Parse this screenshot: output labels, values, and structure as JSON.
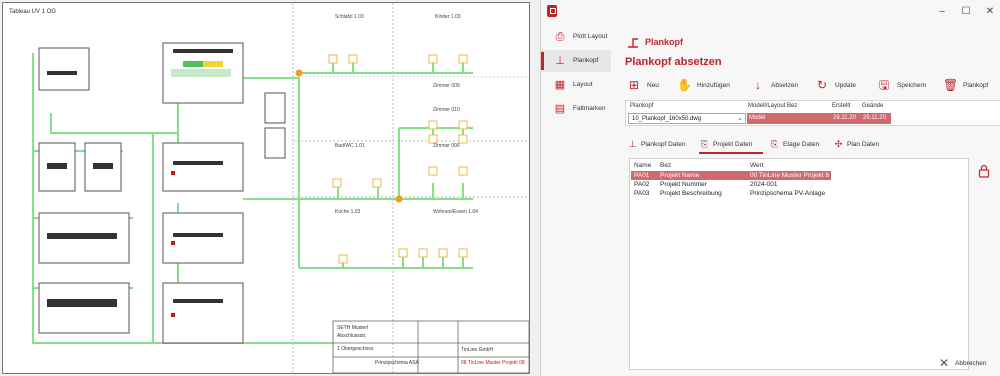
{
  "drawing": {
    "title": "Tableau UV 1 OG",
    "rooms": [
      "Schlafzi 1.03",
      "Kinder 1.03",
      "Zimmer 009",
      "Zimmer 010",
      "Bad/WC 1.01",
      "Zimmer 006",
      "Küche 1.03",
      "Wohnen/Essen 1.04"
    ],
    "titleblock": {
      "r1": "SETH Musterl",
      "r2": "Abschlussstr.",
      "r3": "1 Obergeschoss",
      "r4": "Prinzipschema ASA",
      "r5": "TinLine GmbH",
      "r6": "08 TinLine Muster Projekt 08"
    }
  },
  "window": {
    "minimize": "–",
    "maximize": "☐",
    "close": "✕"
  },
  "sidebar": {
    "items": [
      {
        "label": "Plott Layout",
        "icon": "plotter-icon"
      },
      {
        "label": "Plankopf",
        "icon": "plankopf-icon"
      },
      {
        "label": "Layout",
        "icon": "layout-icon"
      },
      {
        "label": "Faltmarken",
        "icon": "fold-marks-icon"
      }
    ]
  },
  "header": {
    "section": "Plankopf",
    "title": "Plankopf absetzen"
  },
  "toolbar": {
    "neu": "Neu",
    "hinzufuegen": "Hinzufügen",
    "absetzen": "Absetzen",
    "update": "Update",
    "speichern": "Speichern",
    "plankopf": "Plankopf"
  },
  "grid": {
    "headers": {
      "plankopf": "Plankopf",
      "modell": "Modell/Layout Bez",
      "erstellt": "Erstellt",
      "geaendert": "Geände"
    },
    "row": {
      "plankopf": "10_Plankopf_160x50.dwg",
      "modell": "Model",
      "erstellt": "29.11.20",
      "geaendert": "29.11.20"
    }
  },
  "subtabs": {
    "plankopf_daten": "Plankopf Daten",
    "projekt_daten": "Projekt Daten",
    "etage_daten": "Etage Daten",
    "plan_daten": "Plan Daten"
  },
  "list": {
    "headers": {
      "name": "Name",
      "bez": "Bez",
      "wert": "Wert"
    },
    "rows": [
      {
        "name": "PA01",
        "bez": "Projekt Name",
        "wert": "00 TinLine Muster Projekt 6"
      },
      {
        "name": "PA02",
        "bez": "Projekt Nummer",
        "wert": "2024-001"
      },
      {
        "name": "PA03",
        "bez": "Projekt Beschreibung",
        "wert": "Prinzipschema PV-Anlage"
      }
    ]
  },
  "footer": {
    "cancel": "Abbrechen"
  }
}
